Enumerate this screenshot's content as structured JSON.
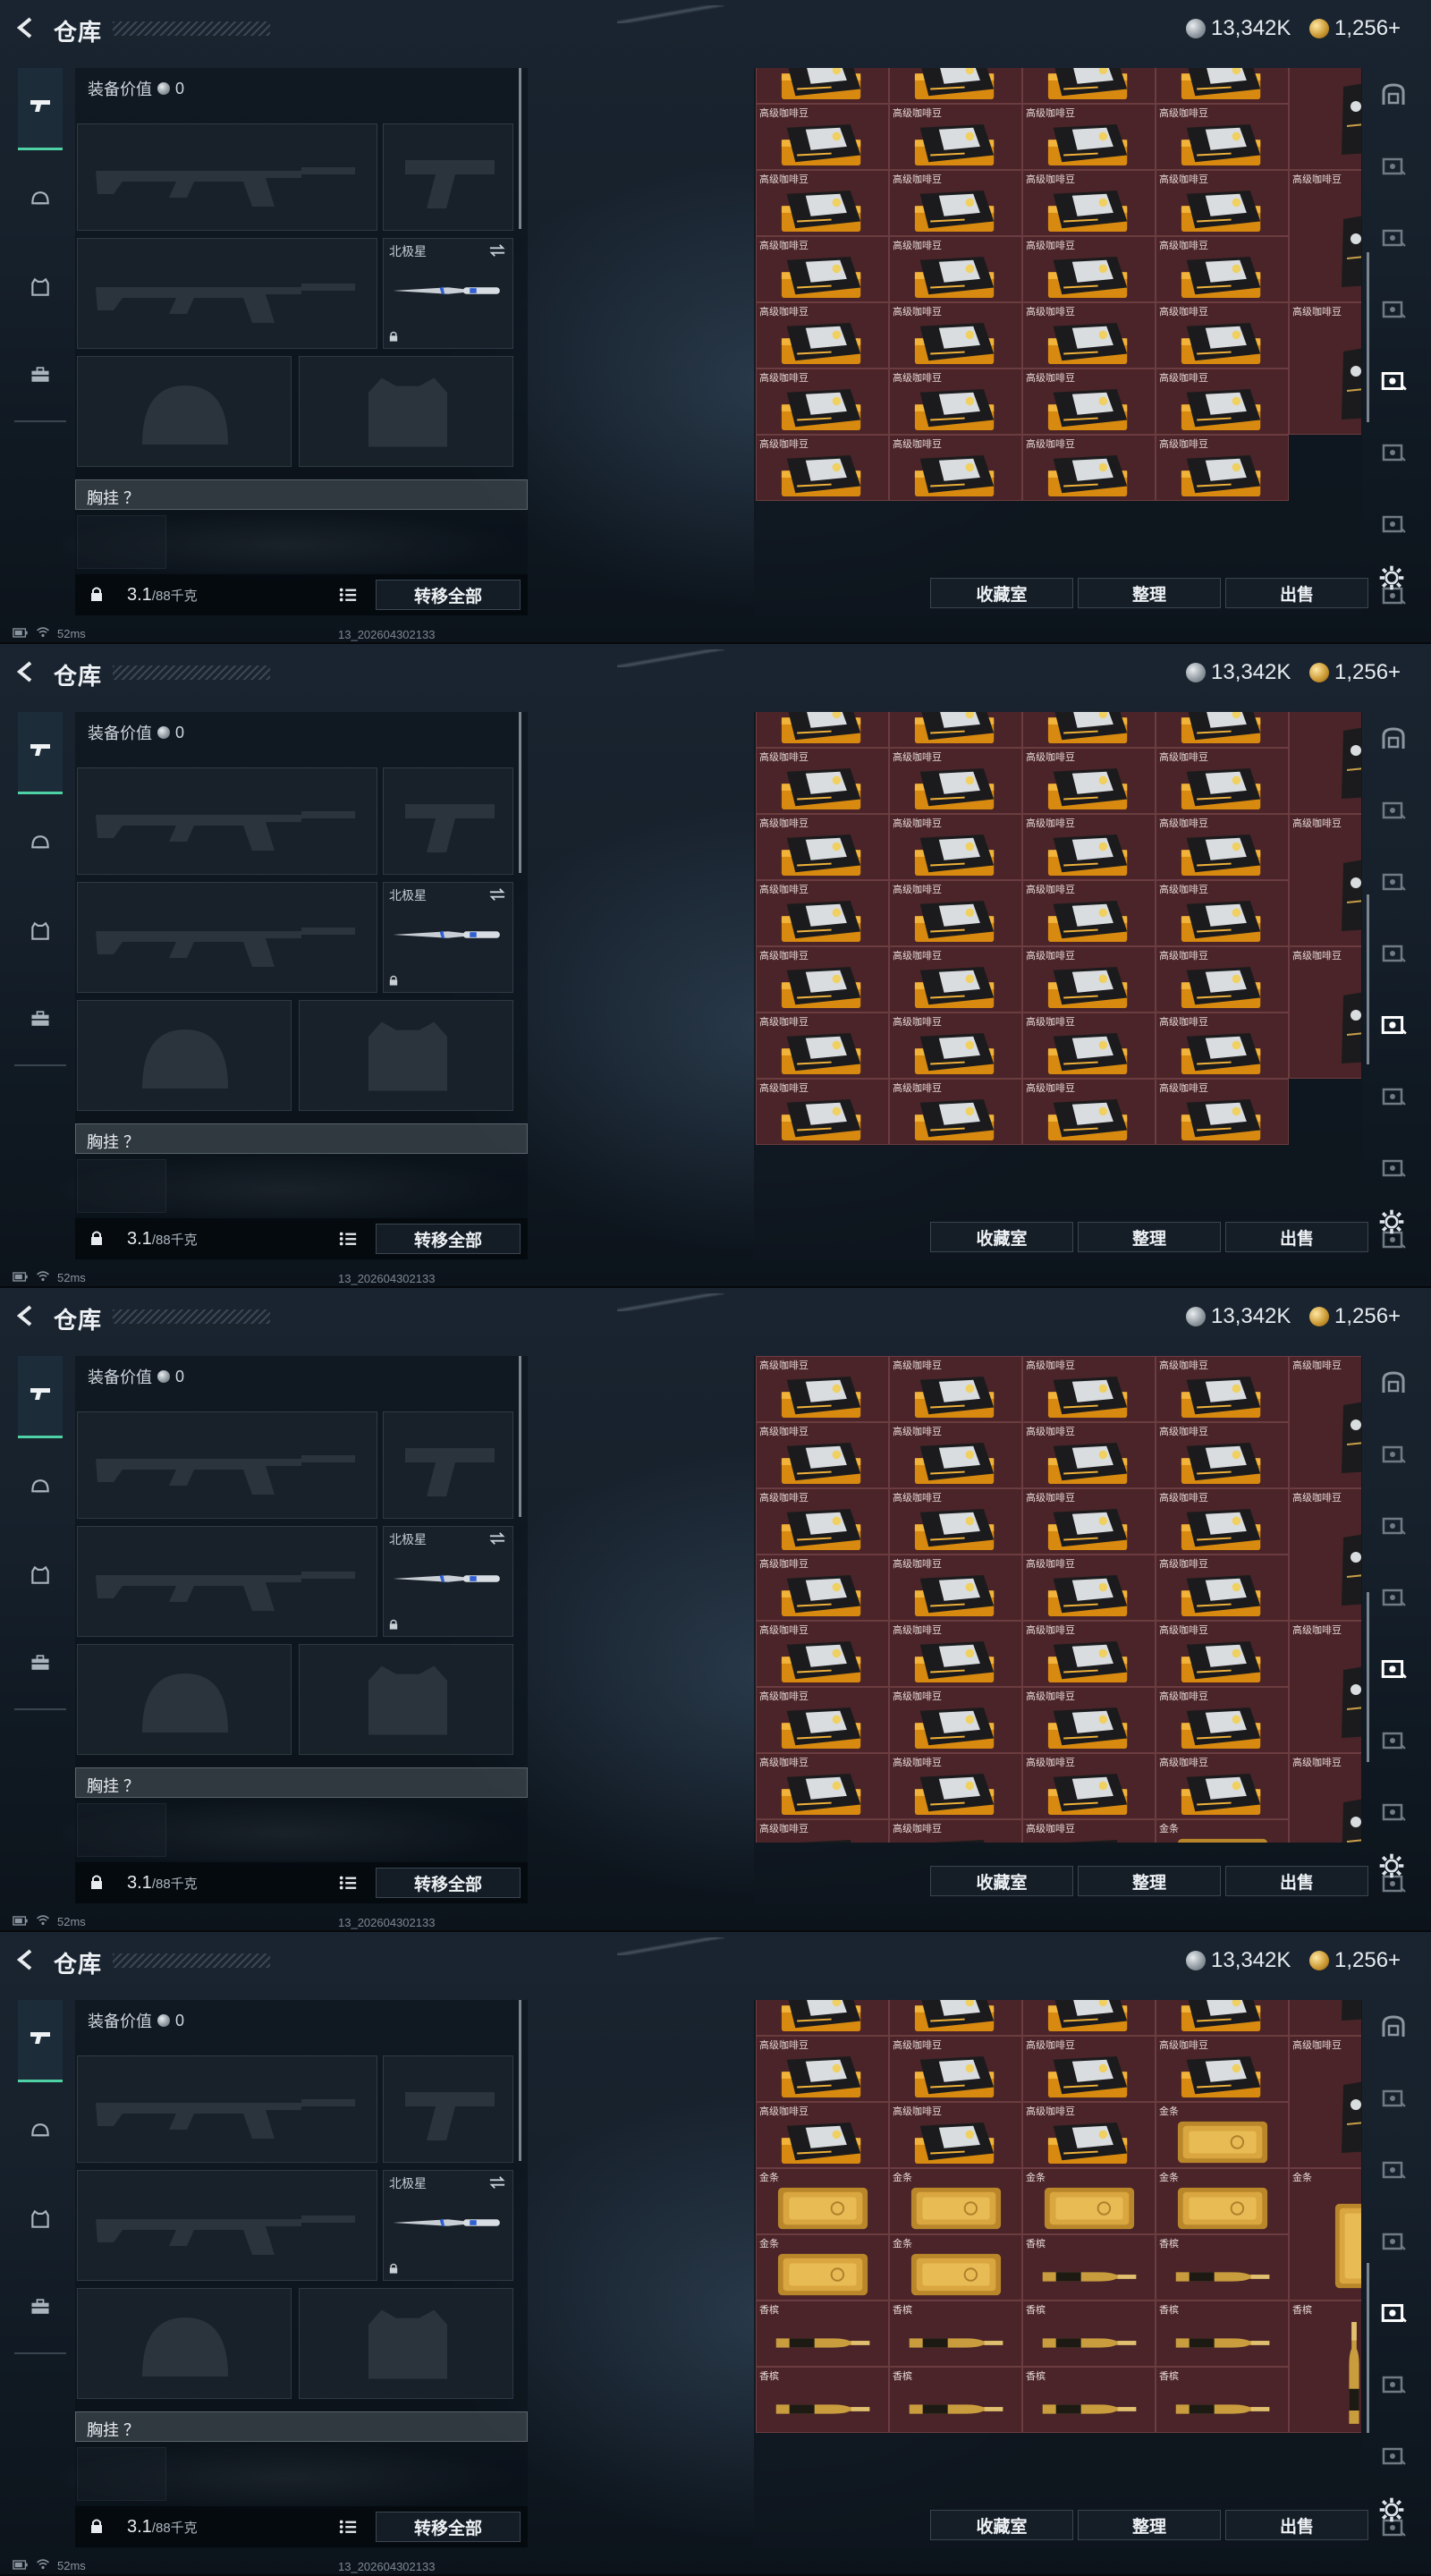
{
  "header": {
    "title": "仓库",
    "currency_silver": "13,342K",
    "currency_gold": "1,256+"
  },
  "equipment": {
    "value_label": "装备价值",
    "value": "0",
    "knife_slot_label": "北极星",
    "chest_label": "胸挂 ？",
    "weight_value": "3.1",
    "weight_capacity": "/88千克",
    "transfer_all": "转移全部"
  },
  "storage": {
    "buttons": [
      "收藏室",
      "整理",
      "出售"
    ],
    "item_coffee": "高级咖啡豆",
    "item_gold": "金条",
    "item_champagne": "香槟"
  },
  "status": {
    "ping": "52ms",
    "build": "13_202604302133"
  },
  "colors": {
    "cell_bg": "#4a2428",
    "accent": "#4fd1a6"
  }
}
